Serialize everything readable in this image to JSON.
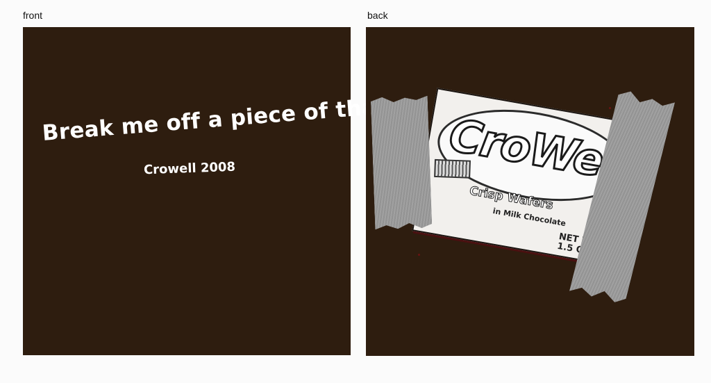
{
  "captions": {
    "front": "front",
    "back": "back"
  },
  "front": {
    "tagline": "Break me off a piece of that",
    "credit": "Crowell 2008"
  },
  "back": {
    "brand": "CroWell",
    "subtitle": "Crisp Wafers",
    "subtitle2": "in Milk Chocolate",
    "net_wt_line1": "NET WT",
    "net_wt_line2": "1.5 OZ (42 g",
    "colors": {
      "panel": "#2e1d0f",
      "tape": "#9b9b9b",
      "wrapper": "#f2f0ed"
    }
  }
}
